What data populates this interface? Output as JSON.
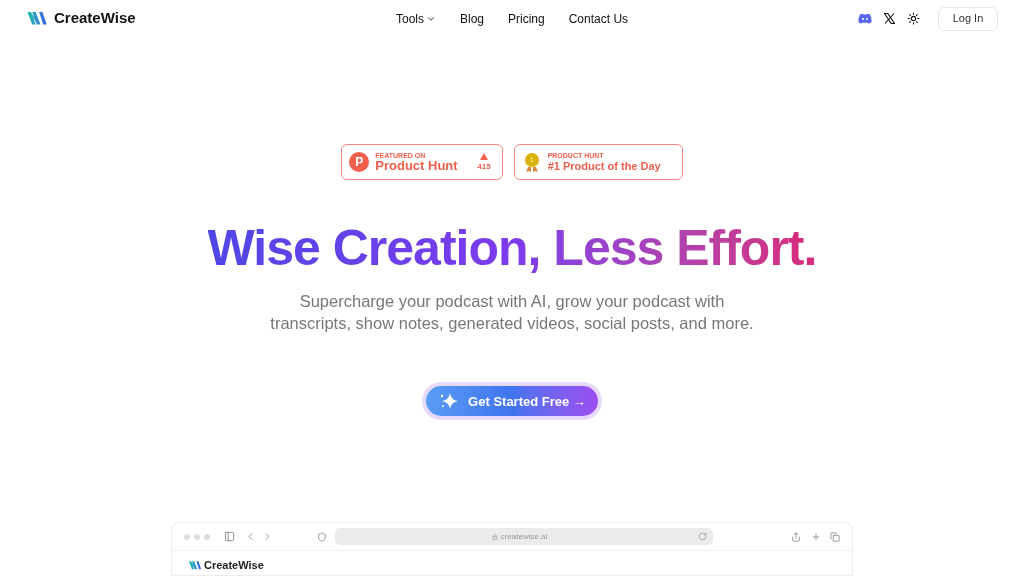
{
  "nav": {
    "brand": "CreateWise",
    "links": [
      {
        "label": "Tools",
        "dropdown": true
      },
      {
        "label": "Blog",
        "dropdown": false
      },
      {
        "label": "Pricing",
        "dropdown": false
      },
      {
        "label": "Contact Us",
        "dropdown": false
      }
    ],
    "login": "Log In"
  },
  "badges": [
    {
      "kind": "featured",
      "caption": "FEATURED ON",
      "logo_letter": "P",
      "title": "Product Hunt",
      "count": "415"
    },
    {
      "kind": "award",
      "caption": "PRODUCT HUNT",
      "title": "#1 Product of the Day",
      "medal": "1"
    }
  ],
  "hero": {
    "headline": "Wise Creation, Less Effort.",
    "subtitle": "Supercharge your podcast with AI, grow your podcast with transcripts, show notes, generated videos, social posts, and more.",
    "cta": "Get Started Free →"
  },
  "preview": {
    "url": "createwise.ai",
    "brand": "CreateWise"
  }
}
